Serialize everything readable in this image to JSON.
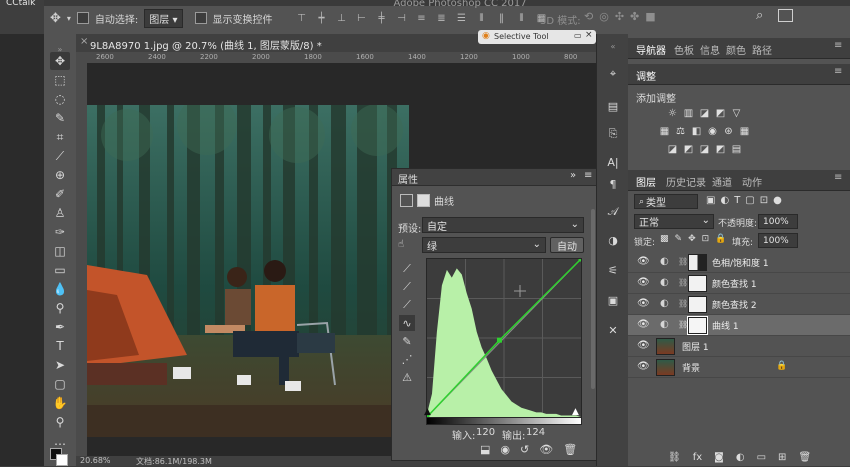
{
  "window": {
    "app_title": "Adobe Photoshop CC 2017",
    "cctalk_label": "CCtalk"
  },
  "options_bar": {
    "auto_select_label": "自动选择:",
    "auto_select_value": "图层",
    "show_transform_label": "显示变换控件",
    "mode_3d_label": "3D 模式:"
  },
  "document": {
    "tab_title": "9L8A8970 1.jpg @ 20.7% (曲线 1, 图层蒙版/8) *",
    "ruler_ticks": [
      "2600",
      "2400",
      "2200",
      "2000",
      "1800",
      "1600",
      "1400",
      "1200",
      "1000",
      "800"
    ],
    "zoom": "20.68%",
    "doc_info": "文档:86.1M/198.3M"
  },
  "floating_tool": {
    "title": "Selective Tool"
  },
  "properties": {
    "title": "属性",
    "panel_type": "曲线",
    "preset_label": "预设:",
    "preset_value": "自定",
    "channel_value": "绿",
    "auto_button": "自动",
    "input_label": "输入:",
    "input_value": "120",
    "output_label": "输出:",
    "output_value": "124",
    "curve_points": [
      {
        "input": 0,
        "output": 0
      },
      {
        "input": 120,
        "output": 124
      },
      {
        "input": 255,
        "output": 255
      }
    ],
    "curve_color": "#2fd12f",
    "histogram_color": "#b8f0a8"
  },
  "right_panel": {
    "top_tabs": [
      "导航器",
      "色板",
      "信息",
      "颜色",
      "路径"
    ],
    "adjust_title": "调整",
    "adjust_add_label": "添加调整",
    "layers_tabs": [
      "图层",
      "历史记录",
      "通道",
      "动作"
    ],
    "kind_filter": "类型",
    "blend_mode": "正常",
    "opacity_label": "不透明度:",
    "opacity_value": "100%",
    "lock_label": "锁定:",
    "fill_label": "填充:",
    "fill_value": "100%",
    "layers": [
      {
        "name": "色相/饱和度 1",
        "type": "adjustment",
        "selected": false
      },
      {
        "name": "颜色查找 1",
        "type": "adjustment",
        "selected": false
      },
      {
        "name": "颜色查找 2",
        "type": "adjustment",
        "selected": false
      },
      {
        "name": "曲线 1",
        "type": "adjustment",
        "selected": true
      },
      {
        "name": "图层 1",
        "type": "pixel",
        "selected": false
      },
      {
        "name": "背景",
        "type": "background",
        "selected": false
      }
    ]
  }
}
